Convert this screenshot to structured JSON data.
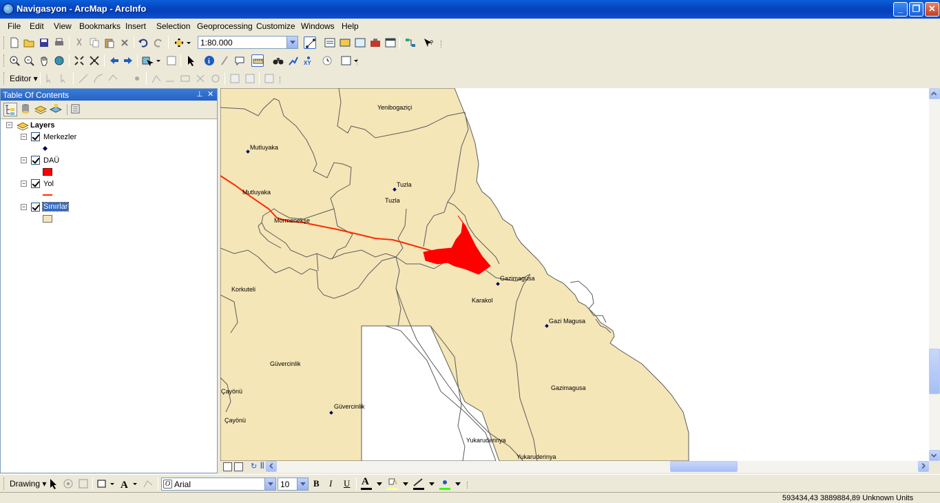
{
  "window": {
    "title": "Navigasyon - ArcMap - ArcInfo",
    "minimize_glyph": "_",
    "restore_glyph": "❐",
    "close_glyph": "✕"
  },
  "menu": [
    "File",
    "Edit",
    "View",
    "Bookmarks",
    "Insert",
    "Selection",
    "Geoprocessing",
    "Customize",
    "Windows",
    "Help"
  ],
  "standard_toolbar": {
    "scale_value": "1:80.000"
  },
  "editor_toolbar": {
    "editor_label": "Editor ▾"
  },
  "toc": {
    "title": "Table Of Contents",
    "pin_glyph": "⊥",
    "close_glyph": "✕",
    "root_label": "Layers",
    "layers": [
      {
        "name": "Merkezler",
        "symbol": "point",
        "color": "#00005a"
      },
      {
        "name": "DAÜ",
        "symbol": "fill",
        "color": "#ff0000"
      },
      {
        "name": "Yol",
        "symbol": "line",
        "color": "#ff2a00"
      },
      {
        "name": "Sınırlar",
        "symbol": "fill",
        "color": "#f5e6b8"
      }
    ]
  },
  "map": {
    "colors": {
      "land": "#f5e6b8",
      "boundary": "#5a5a5a",
      "road": "#ff2a00",
      "campus": "#ff0000",
      "point": "#00005a",
      "water": "#ffffff"
    },
    "labels": {
      "yenibogazici": "Yenibogaziçi",
      "mutluyaka1": "Mutluyaka",
      "mutluyaka2": "Mutluyaka",
      "tuzla1": "Tuzla",
      "tuzla2": "Tuzla",
      "mormenekse": "Mormenekşe",
      "gazimagusa1": "Gazimagusa",
      "korkuteli": "Korkuteli",
      "karakol": "Karakol",
      "gazimagusa2": "Gazi Magusa",
      "guvercinlik1": "Güvercinlik",
      "cayonu1": "Çayönü",
      "guvercinlik2": "Güvercinlik",
      "cayonu2": "Çayönü",
      "gazimagusa3": "Gazimagusa",
      "yukaruderinya1": "Yukaruderinya",
      "yukaruderinya2": "Yukaruderinya"
    }
  },
  "drawing_toolbar": {
    "drawing_label": "Drawing ▾",
    "font_name": "Arial",
    "font_size": "10",
    "bold": "B",
    "italic": "I",
    "underline": "U",
    "font_color_glyph": "A"
  },
  "status": {
    "coordinates": "593434,43  3889884,89 Unknown Units"
  }
}
